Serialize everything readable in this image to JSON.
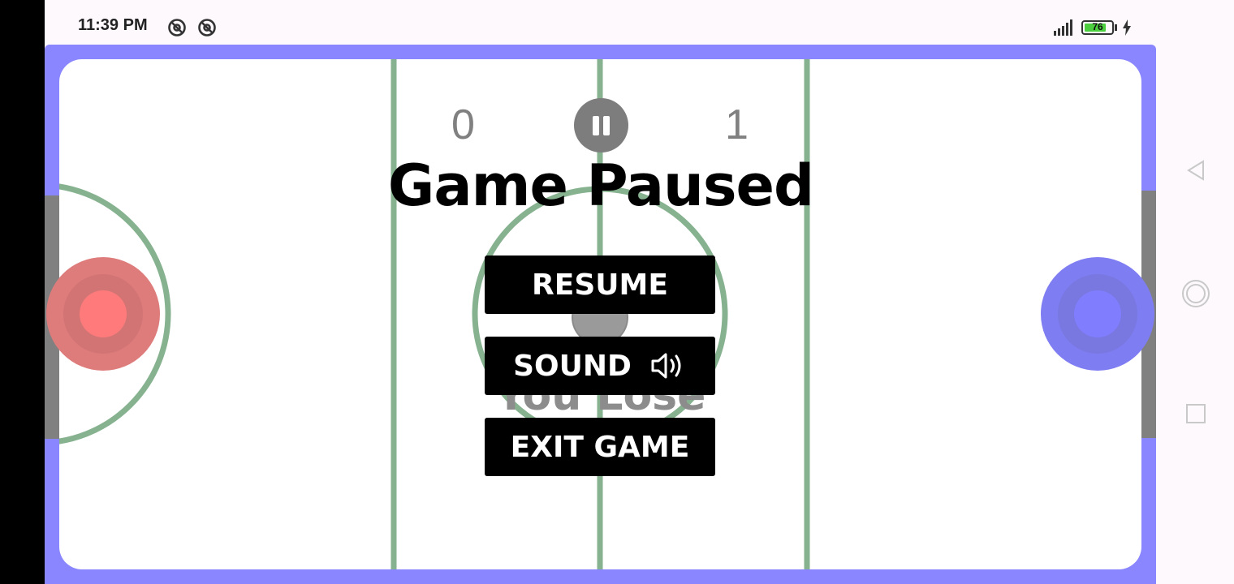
{
  "status_bar": {
    "time": "11:39 PM",
    "icons": [
      "sync-icon",
      "sync-icon"
    ],
    "battery_level": "76",
    "charging": true,
    "signal": "signal-bars-icon"
  },
  "score": {
    "left": "0",
    "right": "1"
  },
  "overlay": {
    "title": "Game Paused",
    "result": "You Lose",
    "resume_label": "RESUME",
    "sound_label": "SOUND",
    "exit_label": "EXIT GAME"
  },
  "nav_bar": {
    "back": "back-icon",
    "home": "home-icon",
    "recents": "recents-icon"
  },
  "colors": {
    "frame": "#8a86ff",
    "lines": "#86b28f",
    "red_mallet": "#ff7878",
    "blue_mallet": "#7f7dfc",
    "goal": "#808080"
  }
}
